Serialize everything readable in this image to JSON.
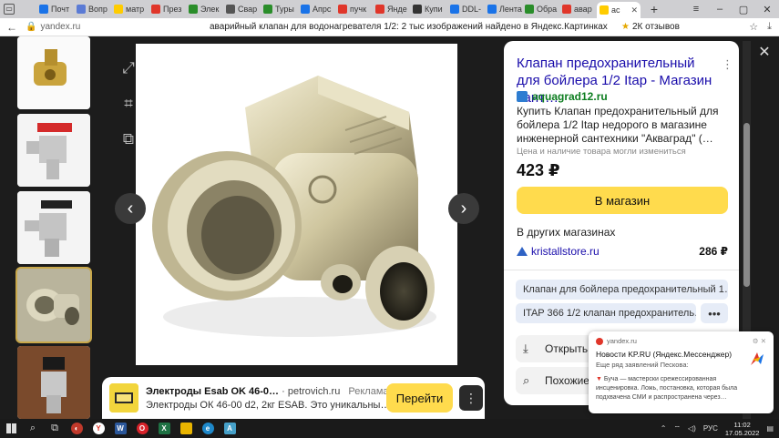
{
  "browser": {
    "tabs": [
      {
        "label": "Почт",
        "color": "#1a73e8"
      },
      {
        "label": "Вопр",
        "color": "#5b7bd5"
      },
      {
        "label": "матр",
        "color": "#ffcc00"
      },
      {
        "label": "През",
        "color": "#e0362a"
      },
      {
        "label": "Элек",
        "color": "#2a8d2a"
      },
      {
        "label": "Свар",
        "color": "#555555"
      },
      {
        "label": "Туры",
        "color": "#2a8d2a"
      },
      {
        "label": "Апрс",
        "color": "#1a73e8"
      },
      {
        "label": "пучк",
        "color": "#e0362a"
      },
      {
        "label": "Янде",
        "color": "#e0362a"
      },
      {
        "label": "Купи",
        "color": "#333333"
      },
      {
        "label": "DDL-",
        "color": "#1a73e8"
      },
      {
        "label": "Лента",
        "color": "#1a73e8"
      },
      {
        "label": "Обра",
        "color": "#2a8d2a"
      },
      {
        "label": "авар",
        "color": "#e0362a"
      }
    ],
    "active_tab": {
      "label": "ас"
    },
    "domain": "yandex.ru",
    "page_title": "аварийный клапан для водонагревателя 1/2: 2 тыс изображений найдено в Яндекс.Картинках",
    "reviews": "2К отзывов"
  },
  "viewer": {
    "tools": [
      "expand-icon",
      "crop-icon",
      "similar-search-icon"
    ]
  },
  "ad": {
    "title": "Электроды Esab OK 46-0…",
    "source": "· petrovich.ru",
    "tag": "Реклама",
    "subtitle": "Электроды ОК 46-00 d2, 2кг ESAB. Это уникальны…",
    "button": "Перейти",
    "more": "⋮"
  },
  "panel": {
    "title": "Клапан предохранительный для бойлера 1/2 Itap - Магазин сант…",
    "site": "aquagrad12.ru",
    "description": "Купить Клапан предохранительный для бойлера 1/2 Itap недорого в магазине инженерной сантехники \"Акваград\" (…",
    "note": "Цена и наличие товара могли измениться",
    "price": "423 ₽",
    "shop_button": "В магазин",
    "other_shops_label": "В других магазинах",
    "other_shop": {
      "name": "kristallstore.ru",
      "price": "286 ₽"
    },
    "chips": [
      "Клапан для бойлера предохранительный 1…",
      "ITAP 366 1/2 клапан предохранитель…"
    ],
    "chip_more": "•••",
    "actions": [
      {
        "label": "Открыть",
        "icon": "download-icon"
      },
      {
        "label": "Похожие",
        "icon": "similar-icon"
      }
    ]
  },
  "notification": {
    "source": "yandex.ru",
    "title": "Новости KP.RU (Яндекс.Мессенджер)",
    "line": "Еще ряд заявлений Пескова:",
    "body": "Буча — мастерски срежессированная инсценировка. Ложь, постановка, которая была подхвачена СМИ и распространена через…"
  },
  "taskbar": {
    "lang": "РУС",
    "time": "11:02",
    "date": "17.05.2022"
  },
  "colors": {
    "accent_yellow": "#ffdb4d",
    "link_blue": "#1a0dab",
    "site_green": "#0c7d1f"
  }
}
